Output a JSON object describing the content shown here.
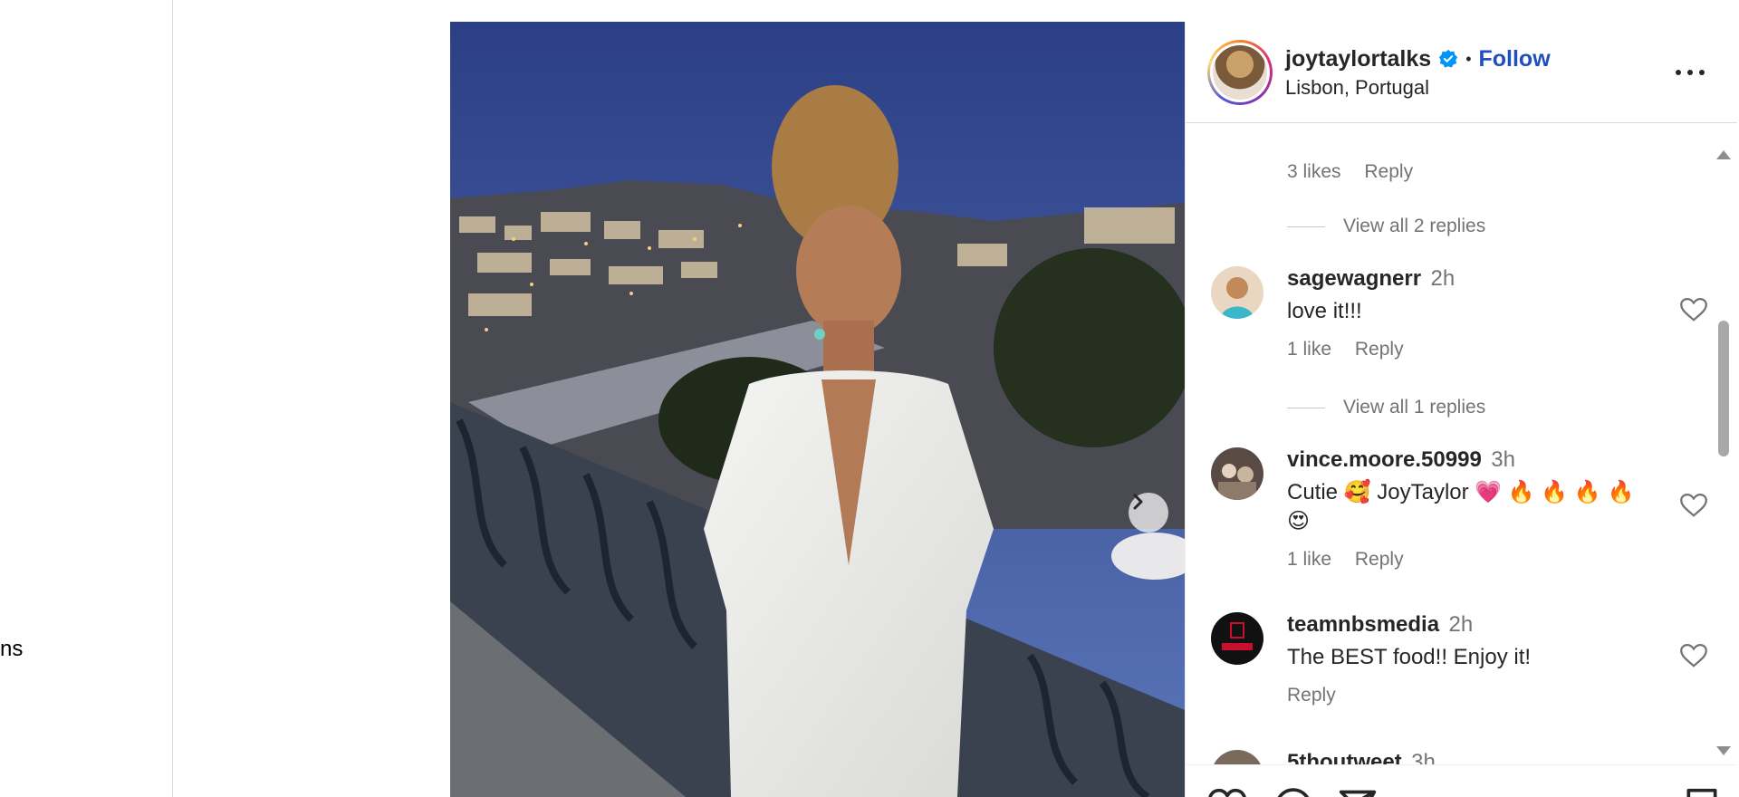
{
  "left_nav": {
    "cut_label": "ns"
  },
  "post": {
    "username": "joytaylortalks",
    "separator": "•",
    "follow_label": "Follow",
    "location": "Lisbon, Portugal"
  },
  "thread_top": {
    "likes": "3 likes",
    "reply": "Reply",
    "view_replies": "View all 2 replies"
  },
  "comments": [
    {
      "user": "sagewagnerr",
      "time": "2h",
      "text": "love it!!!",
      "likes": "1 like",
      "reply": "Reply",
      "view_replies": "View all 1 replies"
    },
    {
      "user": "vince.moore.50999",
      "time": "3h",
      "text": "Cutie 🥰 JoyTaylor 💗 🔥 🔥 🔥 🔥 😍",
      "likes": "1 like",
      "reply": "Reply"
    },
    {
      "user": "teamnbsmedia",
      "time": "2h",
      "text": "The BEST food!! Enjoy it!",
      "reply": "Reply"
    },
    {
      "user": "5thoutweet",
      "time": "3h"
    }
  ],
  "colors": {
    "accent": "#1f4fbf",
    "verified": "#0095f6",
    "secondary_text": "#737373"
  },
  "icons": [
    "verified-icon",
    "more-icon",
    "heart-icon",
    "comment-icon",
    "share-icon",
    "bookmark-icon",
    "chevron-right-icon"
  ]
}
